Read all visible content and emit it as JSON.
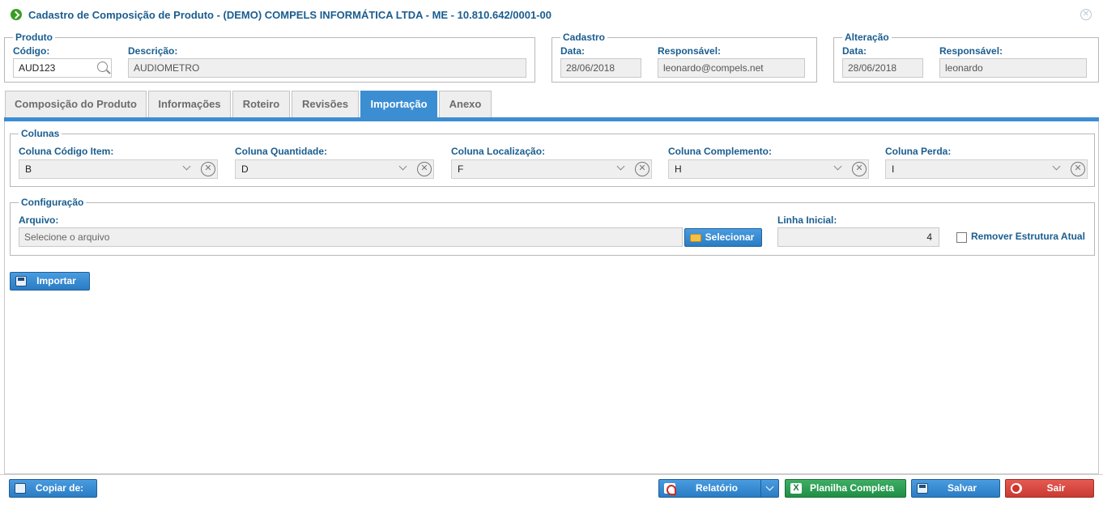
{
  "window": {
    "title": "Cadastro de Composição de Produto - (DEMO) COMPELS INFORMÁTICA LTDA - ME - 10.810.642/0001-00"
  },
  "produto": {
    "legend": "Produto",
    "codigo_label": "Código:",
    "codigo_value": "AUD123",
    "descricao_label": "Descrição:",
    "descricao_value": "AUDIOMETRO"
  },
  "cadastro": {
    "legend": "Cadastro",
    "data_label": "Data:",
    "data_value": "28/06/2018",
    "responsavel_label": "Responsável:",
    "responsavel_value": "leonardo@compels.net"
  },
  "alteracao": {
    "legend": "Alteração",
    "data_label": "Data:",
    "data_value": "28/06/2018",
    "responsavel_label": "Responsável:",
    "responsavel_value": "leonardo"
  },
  "tabs": [
    {
      "label": "Composição do Produto"
    },
    {
      "label": "Informações"
    },
    {
      "label": "Roteiro"
    },
    {
      "label": "Revisões"
    },
    {
      "label": "Importação",
      "active": true
    },
    {
      "label": "Anexo"
    }
  ],
  "colunas": {
    "legend": "Colunas",
    "fields": [
      {
        "label": "Coluna Código Item:",
        "value": "B"
      },
      {
        "label": "Coluna Quantidade:",
        "value": "D"
      },
      {
        "label": "Coluna Localização:",
        "value": "F"
      },
      {
        "label": "Coluna Complemento:",
        "value": "H"
      },
      {
        "label": "Coluna Perda:",
        "value": "I"
      }
    ]
  },
  "configuracao": {
    "legend": "Configuração",
    "arquivo_label": "Arquivo:",
    "arquivo_placeholder": "Selecione o arquivo",
    "selecionar_label": "Selecionar",
    "linha_label": "Linha Inicial:",
    "linha_value": "4",
    "remover_label": "Remover Estrutura Atual",
    "remover_checked": false
  },
  "actions": {
    "importar_label": "Importar"
  },
  "footer": {
    "copiar_label": "Copiar de:",
    "relatorio_label": "Relatório",
    "planilha_label": "Planilha Completa",
    "salvar_label": "Salvar",
    "sair_label": "Sair"
  }
}
